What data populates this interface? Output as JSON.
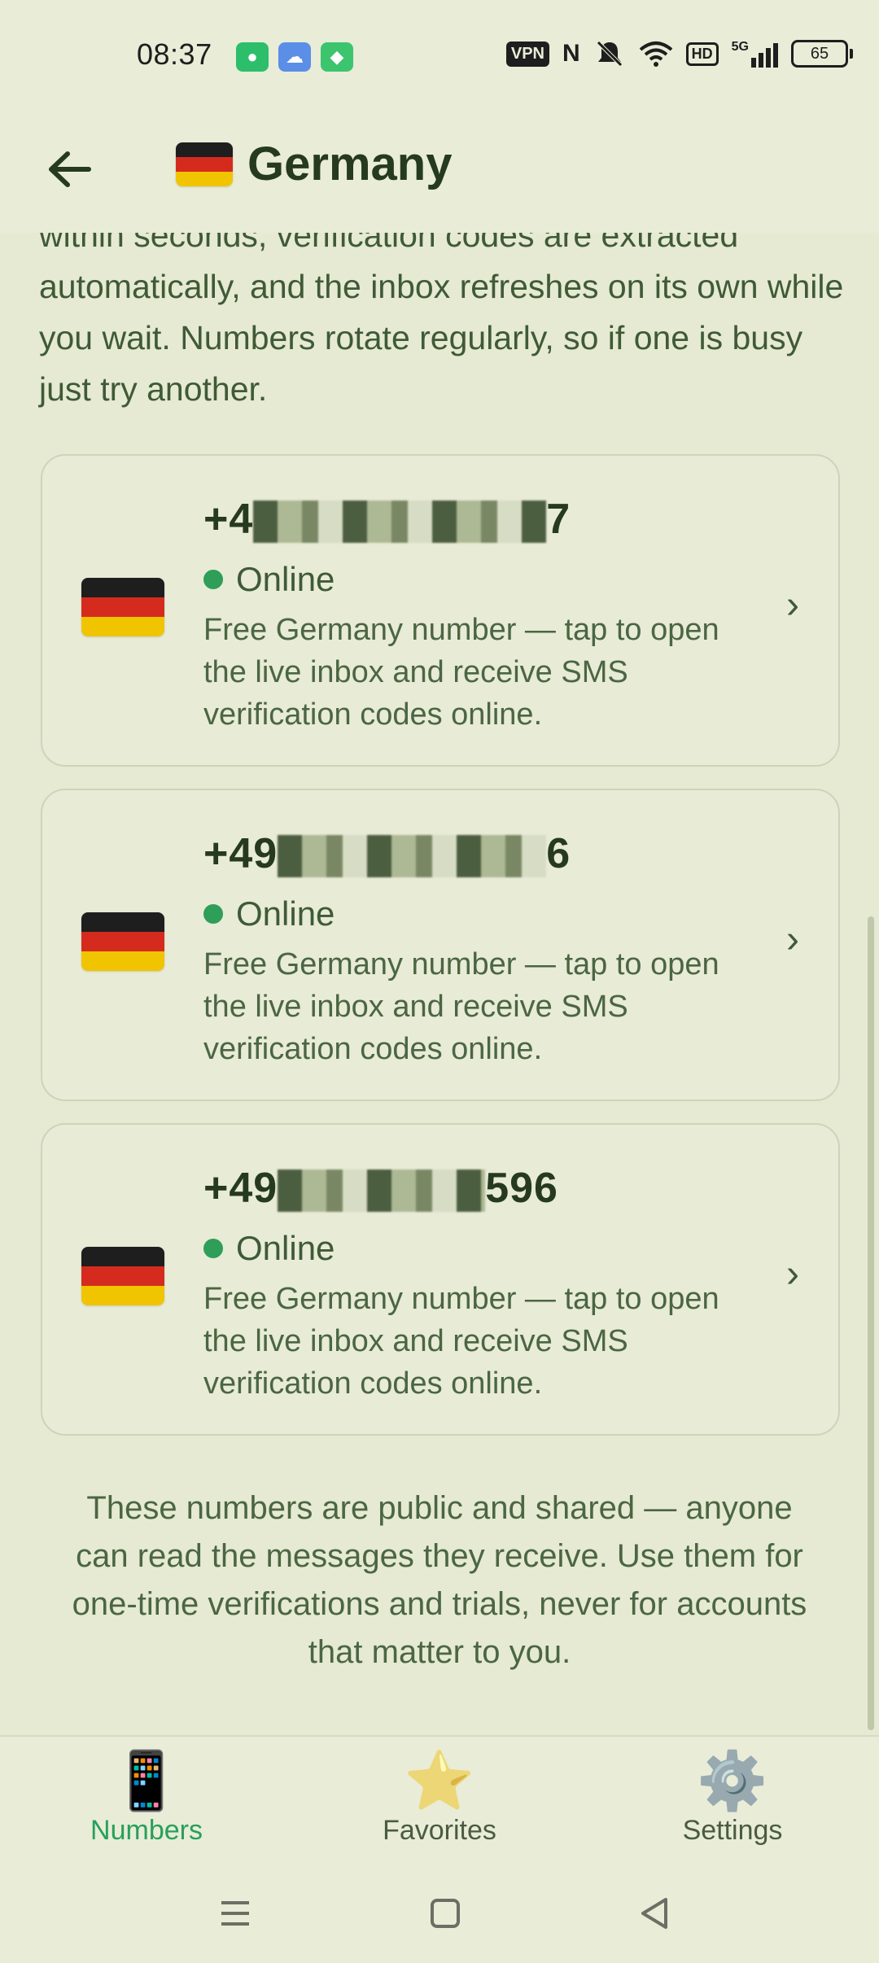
{
  "status_bar": {
    "time": "08:37",
    "vpn": "VPN",
    "hd": "HD",
    "network": "5G",
    "battery": "65",
    "icons": [
      "chat-app-icon",
      "weather-app-icon",
      "android-app-icon",
      "nfc-icon",
      "mute-icon",
      "wifi-icon",
      "signal-icon"
    ]
  },
  "header": {
    "title": "Germany",
    "back_icon": "arrow-left-icon"
  },
  "intro_text": "within seconds, verification codes are extracted automatically, and the inbox refreshes on its own while you wait. Numbers rotate regularly, so if one is busy just try another.",
  "cards": [
    {
      "number_prefix": "+4",
      "number_suffix": "7",
      "status": "Online",
      "description": "Free Germany number — tap to open the live inbox and receive SMS verification codes online."
    },
    {
      "number_prefix": "+49",
      "number_suffix": "6",
      "status": "Online",
      "description": "Free Germany number — tap to open the live inbox and receive SMS verification codes online."
    },
    {
      "number_prefix": "+49",
      "number_suffix": "596",
      "status": "Online",
      "description": "Free Germany number — tap to open the live inbox and receive SMS verification codes online."
    }
  ],
  "note": "These numbers are public and shared — anyone can read the messages they receive. Use them for one-time verifications and trials, never for accounts that matter to you.",
  "bottom_nav": [
    {
      "label": "Numbers",
      "icon": "📱",
      "active": true
    },
    {
      "label": "Favorites",
      "icon": "⭐",
      "active": false
    },
    {
      "label": "Settings",
      "icon": "⚙️",
      "active": false
    }
  ],
  "colors": {
    "background": "#E6EAD2",
    "accent": "#27A05A",
    "online_dot": "#2E9E59",
    "flag_black": "#1E1E1E",
    "flag_red": "#D52B1E",
    "flag_gold": "#F0C400"
  }
}
